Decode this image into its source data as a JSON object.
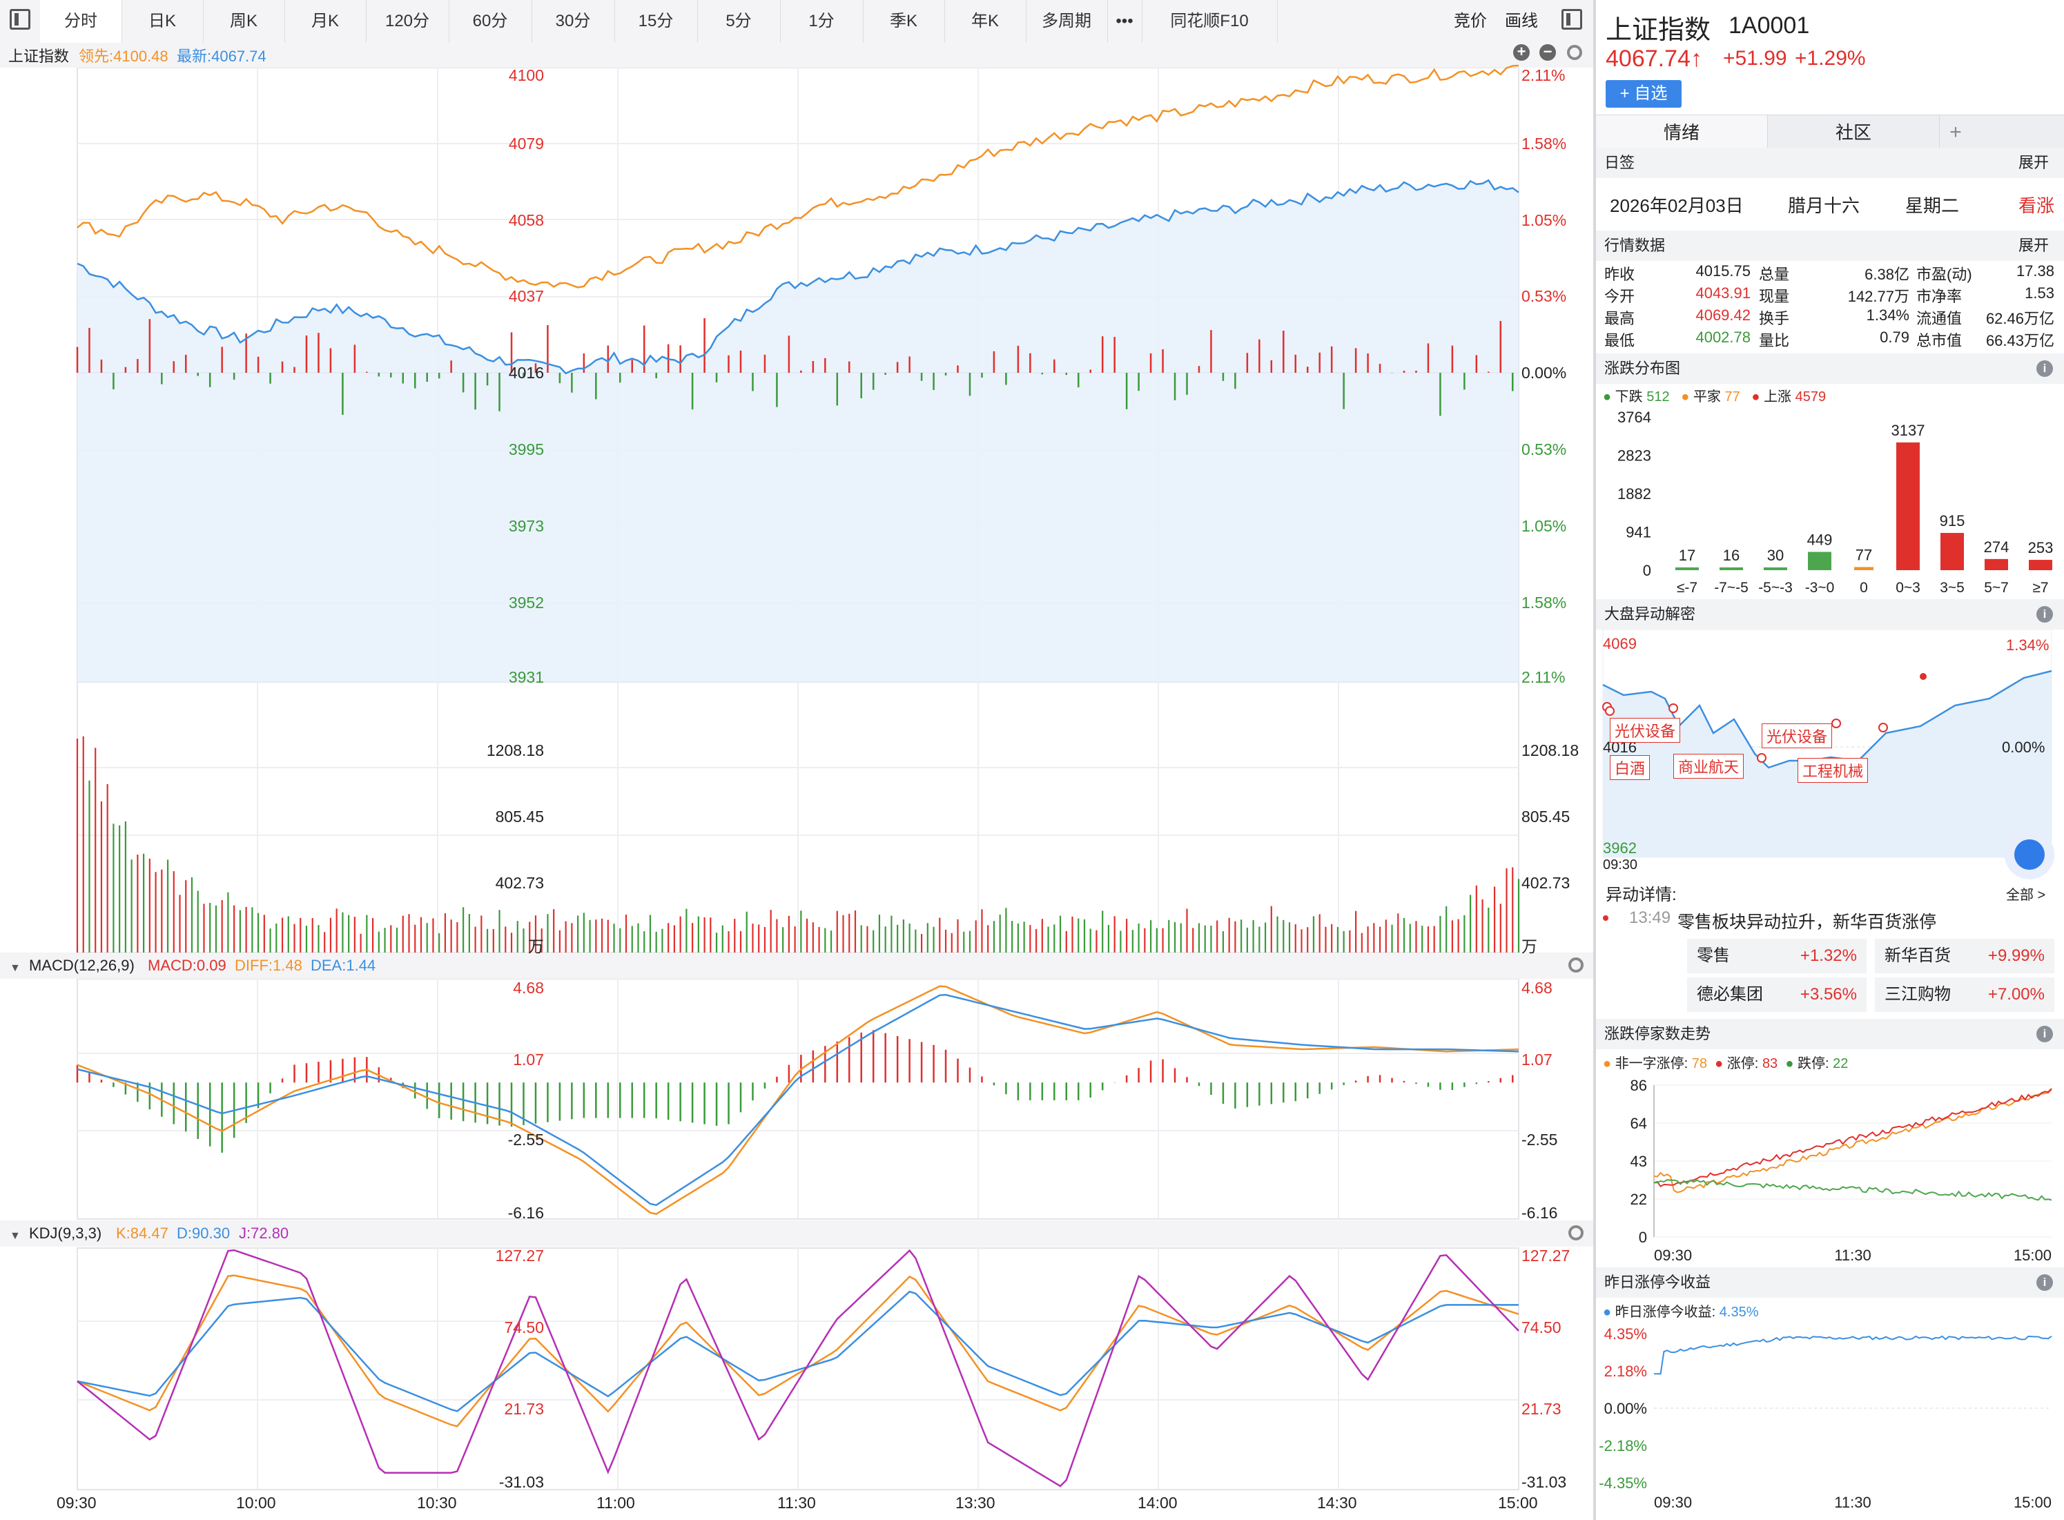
{
  "toolbar": {
    "tabs": [
      "分时",
      "日K",
      "周K",
      "月K",
      "120分",
      "60分",
      "30分",
      "15分",
      "5分",
      "1分",
      "季K",
      "年K",
      "多周期",
      "•••",
      "同花顺F10"
    ],
    "active": "分时",
    "right": [
      "竞价",
      "画线"
    ]
  },
  "main_chart": {
    "name": "上证指数",
    "lead_label": "领先:4100.48",
    "latest_label": "最新:4067.74",
    "left_ticks": [
      "4100",
      "4079",
      "4058",
      "4037",
      "4016",
      "3995",
      "3973",
      "3952",
      "3931"
    ],
    "right_ticks": [
      "2.11%",
      "1.58%",
      "1.05%",
      "0.53%",
      "0.00%",
      "0.53%",
      "1.05%",
      "1.58%",
      "2.11%"
    ],
    "vol_ticks": [
      "1208.18",
      "805.45",
      "402.73",
      "万"
    ],
    "colors": {
      "up": "#e0302c",
      "down": "#3a9a3a",
      "lead": "#f39124",
      "price": "#3b8fe0"
    }
  },
  "macd": {
    "title": "MACD(12,26,9)",
    "macd": "MACD:0.09",
    "diff": "DIFF:1.48",
    "dea": "DEA:1.44",
    "ticks": [
      "4.68",
      "1.07",
      "-2.55",
      "-6.16"
    ]
  },
  "kdj": {
    "title": "KDJ(9,3,3)",
    "k": "K:84.47",
    "d": "D:90.30",
    "j": "J:72.80",
    "ticks": [
      "127.27",
      "74.50",
      "21.73",
      "-31.03"
    ]
  },
  "time_axis": [
    "09:30",
    "10:00",
    "10:30",
    "11:00",
    "11:30",
    "13:30",
    "14:00",
    "14:30",
    "15:00"
  ],
  "chart_data": [
    {
      "type": "line",
      "series": [
        {
          "name": "最新",
          "values": [
            4046,
            4040,
            4033,
            4028,
            4025,
            4030,
            4034,
            4032,
            4028,
            4024,
            4020,
            4018,
            4017,
            4020,
            4019,
            4020,
            4030,
            4039,
            4042,
            4043,
            4047,
            4049,
            4050,
            4052,
            4054,
            4056,
            4058,
            4060,
            4061,
            4063,
            4064,
            4066,
            4067,
            4068,
            4068,
            4067
          ]
        },
        {
          "name": "领先",
          "values": [
            4057,
            4054,
            4063,
            4065,
            4063,
            4058,
            4062,
            4060,
            4052,
            4049,
            4044,
            4041,
            4040,
            4044,
            4047,
            4050,
            4052,
            4057,
            4062,
            4064,
            4066,
            4070,
            4076,
            4079,
            4082,
            4085,
            4086,
            4088,
            4090,
            4092,
            4095,
            4097,
            4097,
            4098,
            4099,
            4100
          ]
        }
      ]
    },
    {
      "type": "bar",
      "title": "成交量(万)",
      "ylim": [
        0,
        1208.18
      ]
    },
    {
      "type": "line",
      "series": [
        {
          "name": "DIFF",
          "values": [
            0.8,
            -0.5,
            -2.2,
            -0.4,
            0.6,
            -0.9,
            -1.8,
            -3.5,
            -6.0,
            -4.0,
            0.5,
            2.8,
            4.4,
            3.0,
            2.2,
            3.2,
            1.7,
            1.5,
            1.6,
            1.4,
            1.5
          ]
        },
        {
          "name": "DEA",
          "values": [
            0.6,
            -0.2,
            -1.4,
            -0.6,
            0.3,
            -0.5,
            -1.3,
            -3.1,
            -5.6,
            -3.5,
            0.2,
            2.2,
            4.0,
            3.2,
            2.4,
            2.9,
            2.0,
            1.7,
            1.5,
            1.5,
            1.4
          ]
        }
      ]
    },
    {
      "type": "line",
      "series": [
        {
          "name": "K",
          "values": [
            40,
            20,
            110,
            100,
            30,
            10,
            70,
            20,
            80,
            30,
            60,
            110,
            40,
            20,
            90,
            70,
            90,
            60,
            100,
            84
          ]
        },
        {
          "name": "D",
          "values": [
            40,
            30,
            90,
            95,
            40,
            20,
            60,
            30,
            70,
            40,
            55,
            100,
            50,
            30,
            80,
            75,
            85,
            65,
            90,
            90
          ]
        },
        {
          "name": "J",
          "values": [
            40,
            0,
            127,
            110,
            -20,
            -20,
            100,
            -20,
            110,
            0,
            80,
            127,
            0,
            -30,
            110,
            60,
            110,
            40,
            125,
            73
          ]
        }
      ]
    },
    {
      "type": "bar",
      "title": "涨跌分布图",
      "categories": [
        "≤-7",
        "-7~-5",
        "-5~-3",
        "-3~0",
        "0",
        "0~3",
        "3~5",
        "5~7",
        "≥7"
      ],
      "values": [
        17,
        16,
        30,
        449,
        77,
        3137,
        915,
        274,
        253
      ],
      "ylim": [
        0,
        3764
      ],
      "yticks": [
        "3764",
        "2823",
        "1882",
        "941",
        "0"
      ]
    }
  ],
  "right_panel": {
    "title": "上证指数",
    "code": "1A0001",
    "price": "4067.74↑",
    "change": "+51.99",
    "pct": "+1.29%",
    "add_btn": "+ 自选",
    "tabs": [
      "情绪",
      "社区",
      "+"
    ],
    "date_section": {
      "title": "日签",
      "expand": "展开",
      "date": "2026年02月03日",
      "lunar": "腊月十六",
      "weekday": "星期二",
      "mood": "看涨"
    },
    "quote_section": {
      "title": "行情数据",
      "expand": "展开",
      "rows": [
        [
          "昨收",
          "4015.75",
          "总量",
          "6.38亿",
          "市盈(动)",
          "17.38"
        ],
        [
          "今开",
          "4043.91",
          "现量",
          "142.77万",
          "市净率",
          "1.53"
        ],
        [
          "最高",
          "4069.42",
          "换手",
          "1.34%",
          "流通值",
          "62.46万亿"
        ],
        [
          "最低",
          "4002.78",
          "量比",
          "0.79",
          "总市值",
          "66.43万亿"
        ]
      ]
    },
    "dist_section": {
      "title": "涨跌分布图",
      "legend": [
        [
          "下跌",
          "512"
        ],
        [
          "平家",
          "77"
        ],
        [
          "上涨",
          "4579"
        ]
      ]
    },
    "anomaly_section": {
      "title": "大盘异动解密",
      "top": "4069",
      "mid": "4016",
      "bottom": "3962",
      "pct": "1.34%",
      "zero": "0.00%",
      "time": "09:30",
      "tags": [
        "光伏设备",
        "白酒",
        "商业航天",
        "光伏设备",
        "工程机械"
      ],
      "detail_title": "异动详情:",
      "all": "全部 >",
      "event_time": "13:49",
      "event_text": "零售板块异动拉升，新华百货涨停",
      "stocks": [
        [
          "零售",
          "+1.32%"
        ],
        [
          "新华百货",
          "+9.99%"
        ],
        [
          "德必集团",
          "+3.56%"
        ],
        [
          "三江购物",
          "+7.00%"
        ]
      ]
    },
    "limit_section": {
      "title": "涨跌停家数走势",
      "legend": [
        [
          "非一字涨停:",
          "78"
        ],
        [
          "涨停:",
          "83"
        ],
        [
          "跌停:",
          "22"
        ]
      ],
      "ticks": [
        "86",
        "64",
        "43",
        "22",
        "0"
      ],
      "times": [
        "09:30",
        "11:30",
        "15:00"
      ]
    },
    "yest_section": {
      "title": "昨日涨停今收益",
      "legend": "昨日涨停今收益:",
      "value": "4.35%",
      "ticks": [
        "4.35%",
        "2.18%",
        "0.00%",
        "-2.18%",
        "-4.35%"
      ],
      "times": [
        "09:30",
        "11:30",
        "15:00"
      ]
    }
  }
}
